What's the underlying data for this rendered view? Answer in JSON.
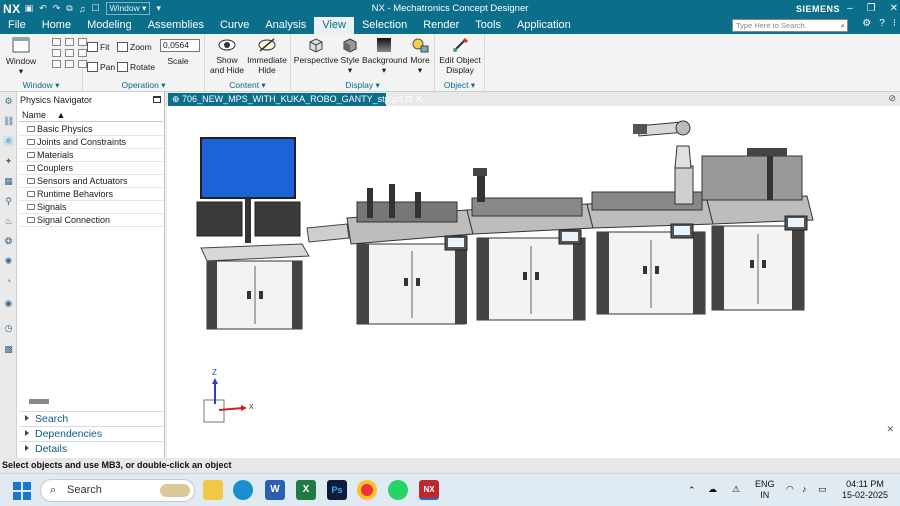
{
  "titlebar": {
    "logo": "NX",
    "window_menu": "Window",
    "title": "NX - Mechatronics Concept Designer",
    "brand": "SIEMENS"
  },
  "menu": {
    "items": [
      {
        "label": "File"
      },
      {
        "label": "Home"
      },
      {
        "label": "Modeling"
      },
      {
        "label": "Assemblies"
      },
      {
        "label": "Curve"
      },
      {
        "label": "Analysis"
      },
      {
        "label": "View"
      },
      {
        "label": "Selection"
      },
      {
        "label": "Render"
      },
      {
        "label": "Tools"
      },
      {
        "label": "Application"
      }
    ],
    "active": "View",
    "search_placeholder": "Type Here to Search"
  },
  "ribbon": {
    "window_group": {
      "button": "Window",
      "label": "Window"
    },
    "operation_group": {
      "fit": "Fit",
      "pan": "Pan",
      "zoom": "Zoom",
      "rotate": "Rotate",
      "scale_label": "Scale",
      "scale_value": "0,0564",
      "label": "Operation"
    },
    "content_group": {
      "show_hide_1": "Show",
      "show_hide_2": "and Hide",
      "immediate_1": "Immediate",
      "immediate_2": "Hide",
      "label": "Content"
    },
    "display_group": {
      "perspective": "Perspective",
      "style": "Style",
      "background": "Background",
      "more": "More",
      "label": "Display"
    },
    "object_group": {
      "edit_1": "Edit Object",
      "edit_2": "Display",
      "label": "Object"
    }
  },
  "navigator": {
    "title": "Physics Navigator",
    "column": "Name",
    "items": [
      {
        "label": "Basic Physics"
      },
      {
        "label": "Joints and Constraints"
      },
      {
        "label": "Materials"
      },
      {
        "label": "Couplers"
      },
      {
        "label": "Sensors and Actuators"
      },
      {
        "label": "Runtime Behaviors"
      },
      {
        "label": "Signals"
      },
      {
        "label": "Signal Connection"
      }
    ],
    "sections": [
      {
        "label": "Search"
      },
      {
        "label": "Dependencies"
      },
      {
        "label": "Details"
      }
    ]
  },
  "document": {
    "tab": "706_NEW_MPS_WITH_KUKA_ROBO_GANTY_stp.prt",
    "axis_x": "X",
    "axis_z": "Z"
  },
  "status": "Select objects and use MB3, or double-click an object",
  "taskbar": {
    "search": "Search",
    "lang_1": "ENG",
    "lang_2": "IN",
    "time": "04:11 PM",
    "date": "15-02-2025"
  },
  "colors": {
    "accent": "#0b6e8a",
    "monitor": "#1e62d8"
  }
}
